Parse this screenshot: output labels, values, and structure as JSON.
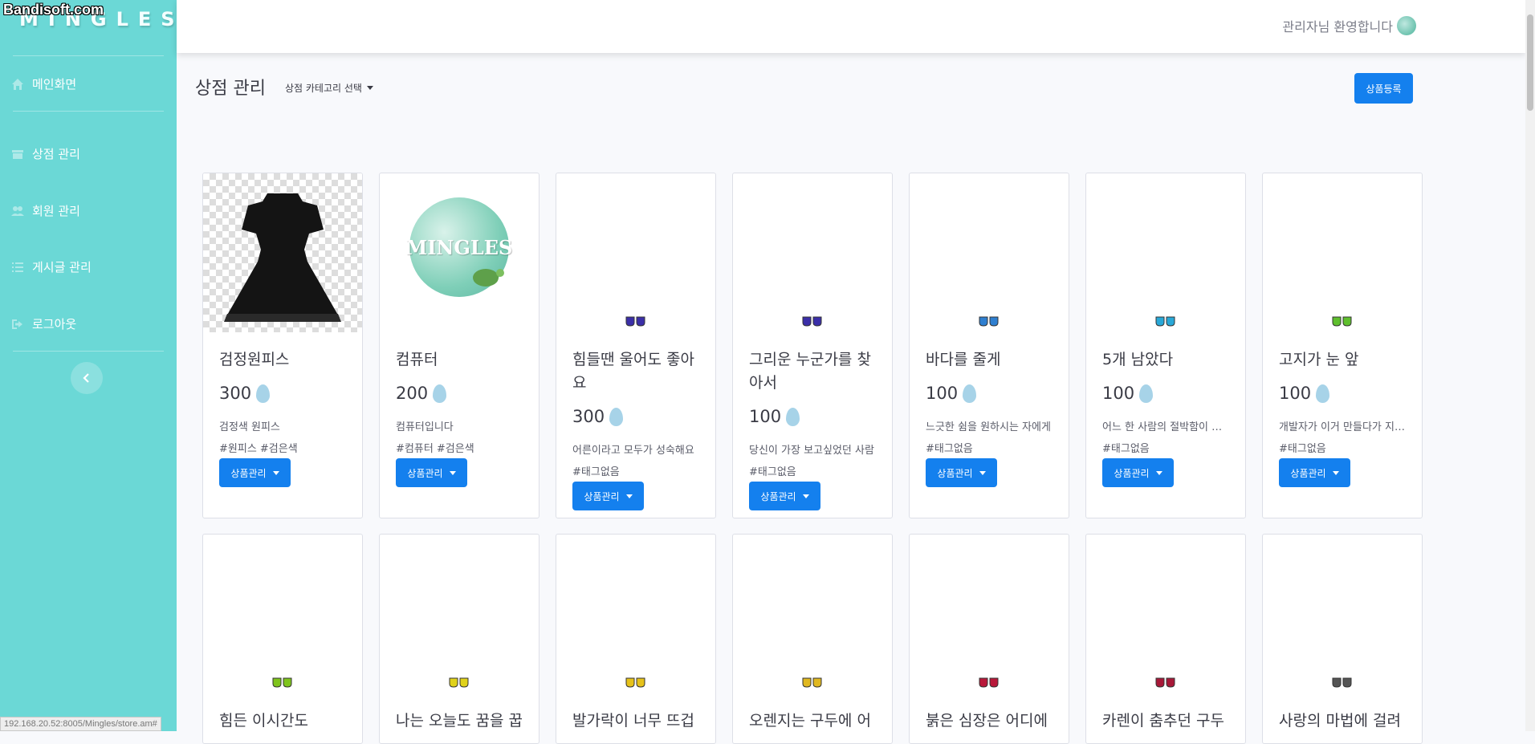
{
  "brand": "MINGLES",
  "watermark": "Bandisoft.com",
  "sidebar": {
    "items": [
      {
        "label": "메인화면",
        "icon": "home-icon"
      },
      {
        "label": "상점 관리",
        "icon": "store-icon"
      },
      {
        "label": "회원 관리",
        "icon": "users-icon"
      },
      {
        "label": "게시글 관리",
        "icon": "list-icon"
      },
      {
        "label": "로그아웃",
        "icon": "logout-icon"
      }
    ]
  },
  "topbar": {
    "welcome": "관리자님 환영합니다"
  },
  "header": {
    "title": "상점 관리",
    "category_dropdown": "상점 카테고리 선택",
    "register_button": "상품등록"
  },
  "manage_label": "상품관리",
  "products": [
    {
      "title": "검정원피스",
      "price": "300",
      "desc": "검정색 원피스",
      "tags": "#원피스 #검은색",
      "image": "black-dress"
    },
    {
      "title": "컴퓨터",
      "price": "200",
      "desc": "컴퓨터입니다",
      "tags": "#컴퓨터 #검은색",
      "image": "mingles-logo"
    },
    {
      "title": "힘들땐 울어도 좋아요",
      "price": "300",
      "desc": "어른이라고 모두가 성숙해요",
      "tags": "#태그없음",
      "image": "shoes",
      "color": "#3b2fa8"
    },
    {
      "title": "그리운 누군가를 찾아서",
      "price": "100",
      "desc": "당신이 가장 보고싶었던 사람",
      "tags": "#태그없음",
      "image": "shoes",
      "color": "#3b2fa8"
    },
    {
      "title": "바다를 줄게",
      "price": "100",
      "desc": "느긋한 쉼을 원하시는 자에게",
      "tags": "#태그없음",
      "image": "shoes",
      "color": "#2f7fd0"
    },
    {
      "title": "5개 남았다",
      "price": "100",
      "desc": "어느 한 사람의 절박함이 담긴",
      "tags": "#태그없음",
      "image": "shoes",
      "color": "#29a8d8"
    },
    {
      "title": "고지가 눈 앞",
      "price": "100",
      "desc": "개발자가 이거 만들다가 지쳐서",
      "tags": "#태그없음",
      "image": "shoes",
      "color": "#5fbf2e"
    },
    {
      "title": "힘든 이시간도",
      "image": "shoes",
      "color": "#7fc41c"
    },
    {
      "title": "나는 오늘도 꿈을 꿉",
      "image": "shoes",
      "color": "#e0d21a"
    },
    {
      "title": "발가락이 너무 뜨겁",
      "image": "shoes",
      "color": "#e6c21a"
    },
    {
      "title": "오렌지는 구두에 어",
      "image": "shoes",
      "color": "#e0b820"
    },
    {
      "title": "붉은 심장은 어디에",
      "image": "shoes",
      "color": "#b8183a"
    },
    {
      "title": "카렌이 춤추던 구두",
      "image": "shoes",
      "color": "#a81838"
    },
    {
      "title": "사랑의 마법에 걸려",
      "image": "shoes",
      "color": "#555555"
    }
  ],
  "statusbar": "192.168.20.52:8005/Mingles/store.am#",
  "colors": {
    "sidebar": "#6bd8d6",
    "primary": "#1480ee",
    "drop": "#a7d3e8"
  }
}
